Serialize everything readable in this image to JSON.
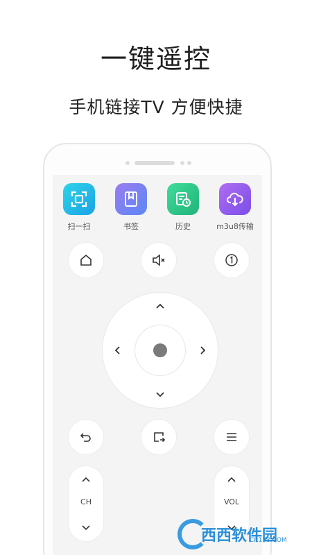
{
  "headline": "一键遥控",
  "subline": "手机链接TV 方便快捷",
  "tools": [
    {
      "label": "扫一扫",
      "icon": "scan-icon"
    },
    {
      "label": "书签",
      "icon": "bookmark-icon"
    },
    {
      "label": "历史",
      "icon": "history-icon"
    },
    {
      "label": "m3u8传输",
      "icon": "cloud-upload-icon"
    }
  ],
  "remote": {
    "ch_label": "CH",
    "vol_label": "VOL"
  },
  "watermark": {
    "text": "西西软件园",
    "domain": "CR173.COM"
  },
  "colors": {
    "accent": "#2a8fd8"
  }
}
